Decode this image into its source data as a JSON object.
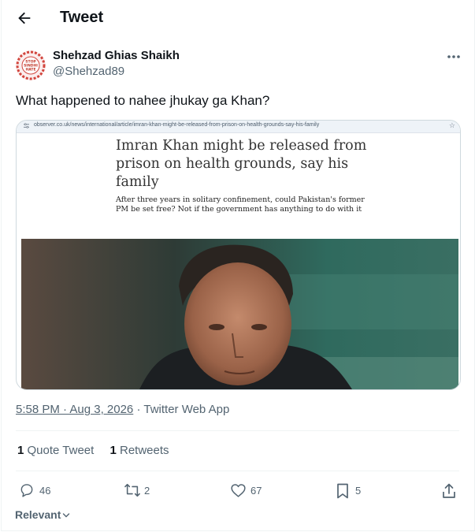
{
  "header": {
    "title": "Tweet"
  },
  "author": {
    "display_name": "Shehzad Ghias Shaikh",
    "handle": "@Shehzad89"
  },
  "tweet": {
    "text": "What happened to nahee jhukay ga Khan?",
    "timestamp": "5:58 PM · Aug 3, 2026",
    "source": "Twitter Web App"
  },
  "card": {
    "url": "observer.co.uk/news/international/article/imran-khan-might-be-released-from-prison-on-health-grounds-say-his-family",
    "headline": "Imran Khan might be released from prison on health grounds, say his family",
    "standfirst": "After three years in solitary confinement, could Pakistan's former PM be set free? Not if the government has anything to do with it"
  },
  "stats": {
    "quote_tweets_count": "1",
    "quote_tweets_label": "Quote Tweet",
    "retweets_count": "1",
    "retweets_label": "Retweets"
  },
  "actions": {
    "replies": "46",
    "retweets": "2",
    "likes": "67",
    "bookmarks": "5"
  },
  "sort": {
    "label": "Relevant"
  },
  "colors": {
    "text": "#0f1419",
    "secondary": "#536471",
    "border": "#eff3f4"
  }
}
